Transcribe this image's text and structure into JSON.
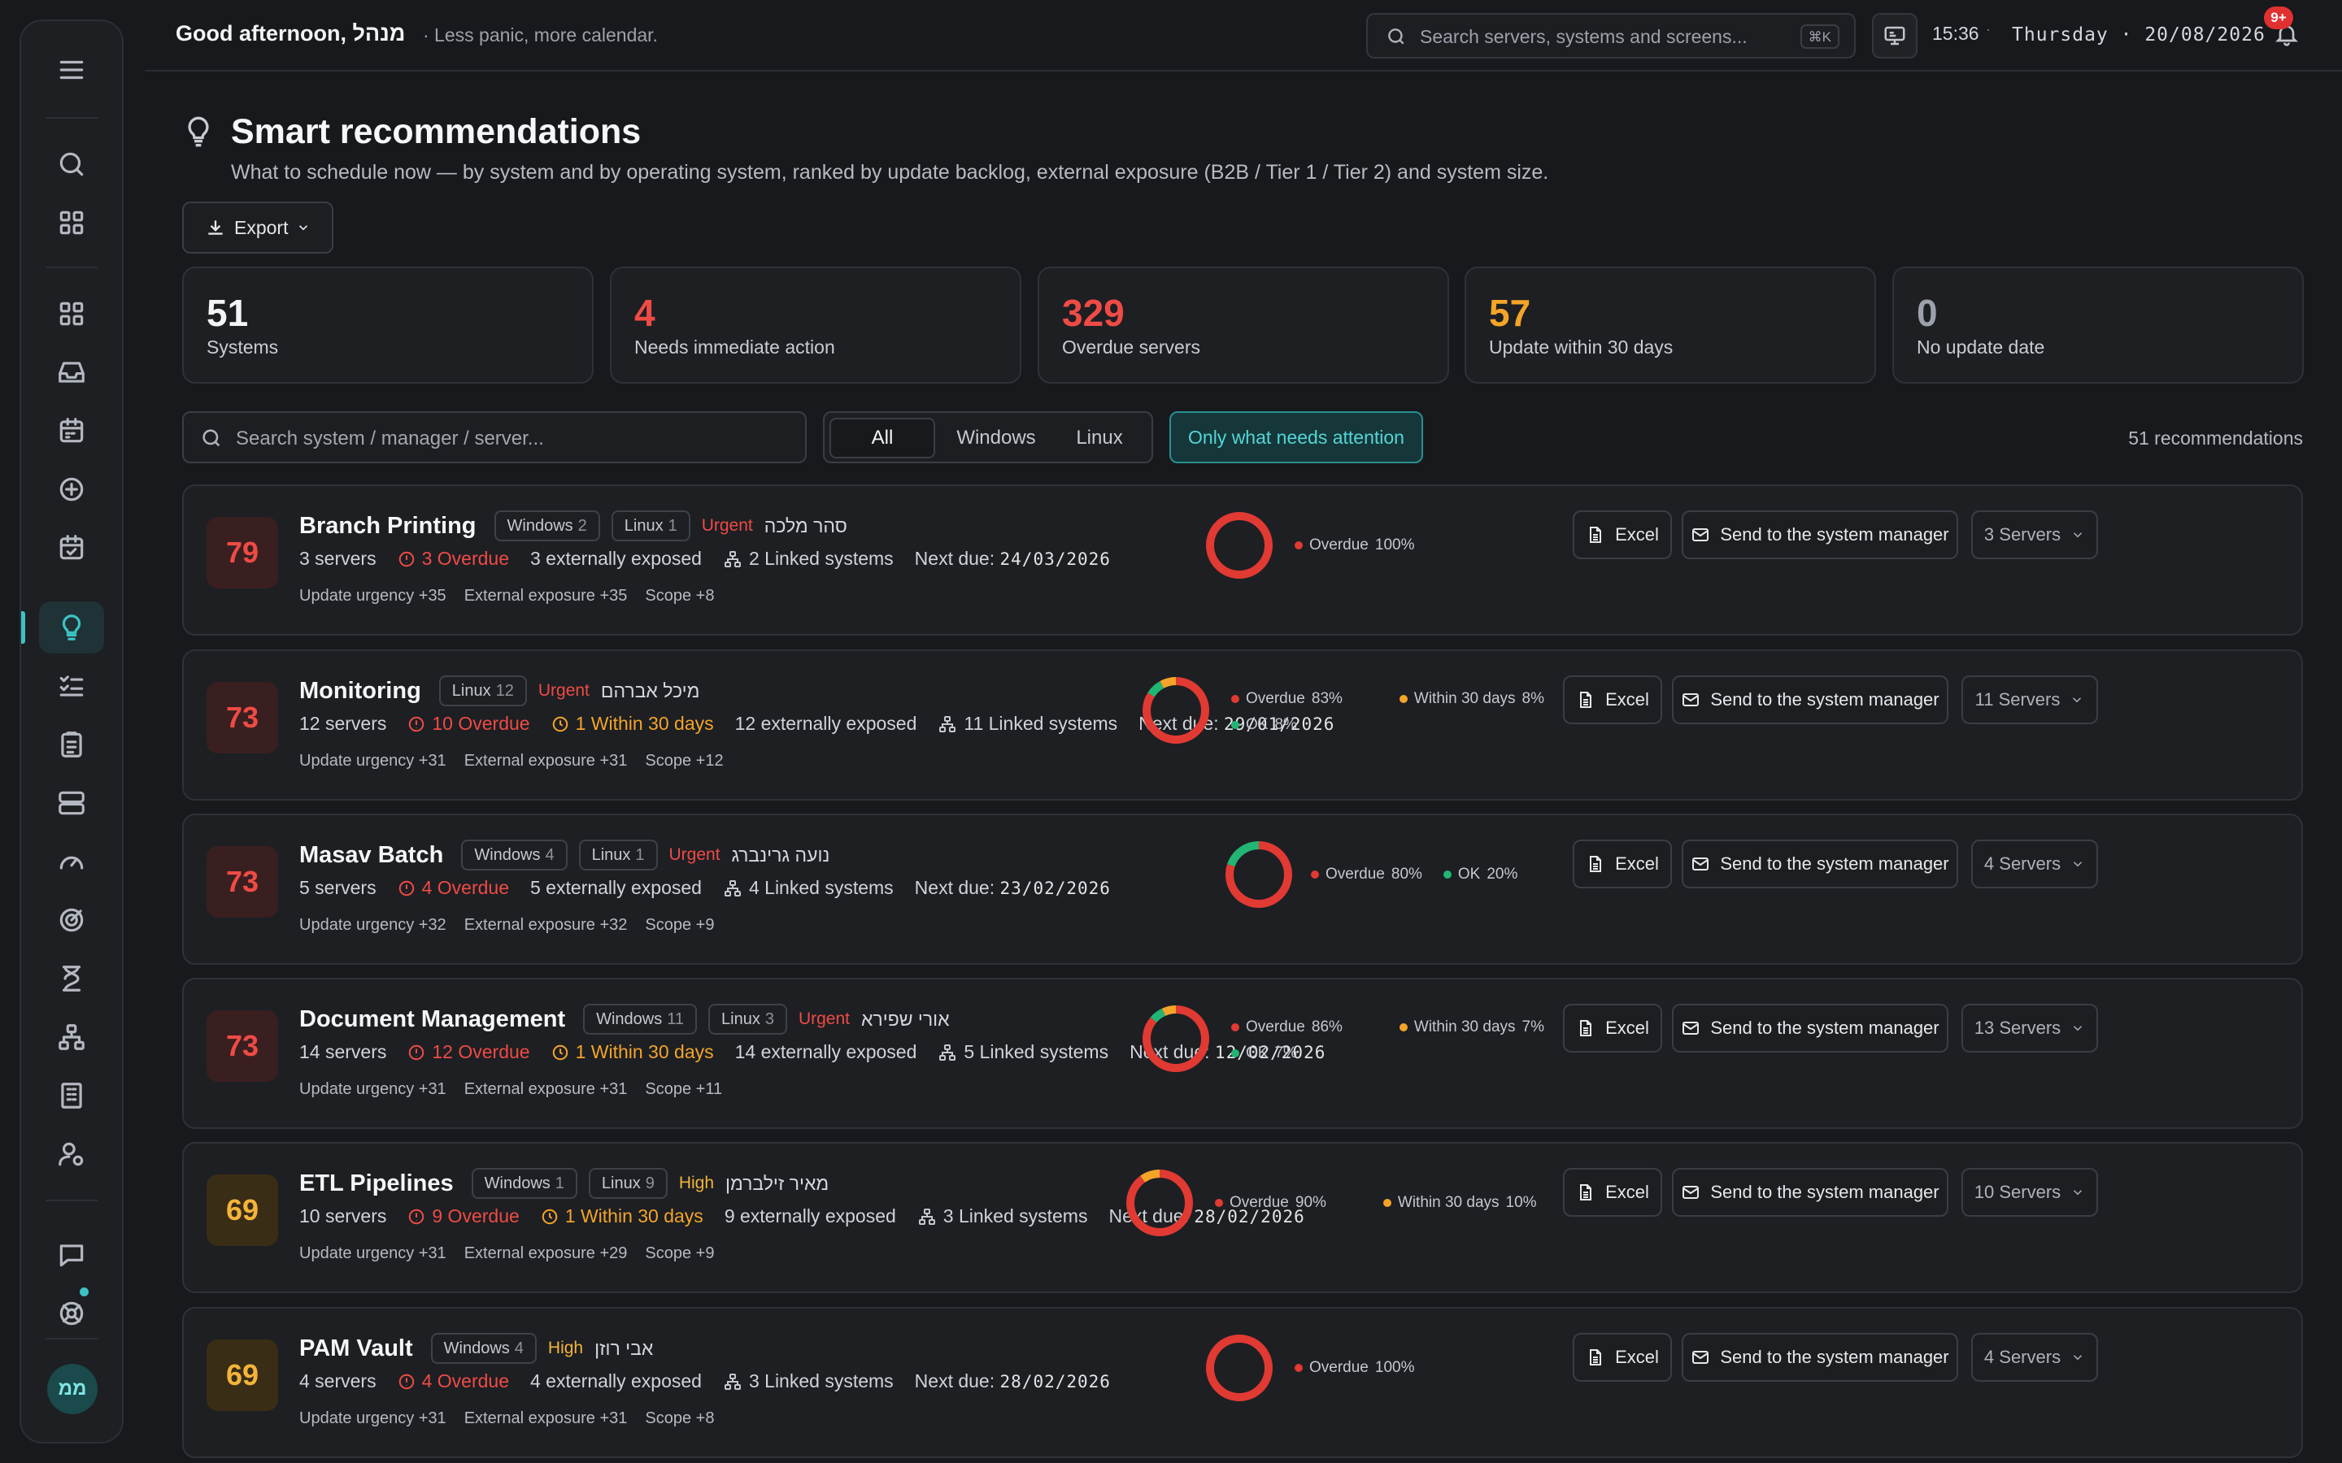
{
  "header": {
    "greeting": "Good afternoon, מנהל",
    "tagline": "· Less panic, more calendar.",
    "search_placeholder": "Search servers, systems and screens...",
    "search_shortcut": "⌘K",
    "time": "15:36",
    "date": "Thursday · 20/08/2026",
    "notifications": "9+"
  },
  "page": {
    "title": "Smart recommendations",
    "subtitle": "What to schedule now — by system and by operating system, ranked by update backlog, external exposure (B2B / Tier 1 / Tier 2) and system size.",
    "export_label": "Export"
  },
  "stats": [
    {
      "value": "51",
      "label": "Systems",
      "color": "#f3f4f6"
    },
    {
      "value": "4",
      "label": "Needs immediate action",
      "color": "#ef4b45"
    },
    {
      "value": "329",
      "label": "Overdue servers",
      "color": "#ef4b45"
    },
    {
      "value": "57",
      "label": "Update within 30 days",
      "color": "#f4a428"
    },
    {
      "value": "0",
      "label": "No update date",
      "color": "#9ca1aa"
    }
  ],
  "filters": {
    "search_placeholder": "Search system / manager / server...",
    "tabs": [
      "All",
      "Windows",
      "Linux"
    ],
    "active_tab": "All",
    "attention_label": "Only what needs attention",
    "count_label": "51 recommendations"
  },
  "colors": {
    "overdue": "#e03a33",
    "within30": "#f4a428",
    "ok": "#22b573",
    "accent": "#3cc3c4"
  },
  "actions": {
    "excel": "Excel",
    "send": "Send to the system manager"
  },
  "cards": [
    {
      "score": "79",
      "priority": "urgent",
      "name": "Branch Printing",
      "os": [
        {
          "name": "Windows",
          "n": "2"
        },
        {
          "name": "Linux",
          "n": "1"
        }
      ],
      "priority_label": "Urgent",
      "owner": "סהר מלכה",
      "servers": "3 servers",
      "overdue": "3 Overdue",
      "within": "",
      "exposed": "3 externally exposed",
      "linked": "2 Linked systems",
      "due_label": "Next due:",
      "due_date": "24/03/2026",
      "urgency": "Update urgency +35",
      "exposure": "External exposure +35",
      "scope": "Scope +8",
      "dist": {
        "overdue": 100,
        "within": 0,
        "ok": 0
      },
      "legend": [
        {
          "label": "Overdue",
          "value": "100%",
          "kind": "overdue"
        }
      ],
      "servers_btn": "3 Servers"
    },
    {
      "score": "73",
      "priority": "urgent",
      "name": "Monitoring",
      "os": [
        {
          "name": "Linux",
          "n": "12"
        }
      ],
      "priority_label": "Urgent",
      "owner": "מיכל אברהם",
      "servers": "12 servers",
      "overdue": "10 Overdue",
      "within": "1 Within 30 days",
      "exposed": "12 externally exposed",
      "linked": "11 Linked systems",
      "due_label": "Next due:",
      "due_date": "29/01/2026",
      "urgency": "Update urgency +31",
      "exposure": "External exposure +31",
      "scope": "Scope +12",
      "dist": {
        "overdue": 83,
        "within": 8,
        "ok": 8
      },
      "legend": [
        {
          "label": "Overdue",
          "value": "83%",
          "kind": "overdue"
        },
        {
          "label": "Within 30 days",
          "value": "8%",
          "kind": "within"
        },
        {
          "label": "OK",
          "value": "8%",
          "kind": "ok"
        }
      ],
      "servers_btn": "11 Servers"
    },
    {
      "score": "73",
      "priority": "urgent",
      "name": "Masav Batch",
      "os": [
        {
          "name": "Windows",
          "n": "4"
        },
        {
          "name": "Linux",
          "n": "1"
        }
      ],
      "priority_label": "Urgent",
      "owner": "נועה גרינברג",
      "servers": "5 servers",
      "overdue": "4 Overdue",
      "within": "",
      "exposed": "5 externally exposed",
      "linked": "4 Linked systems",
      "due_label": "Next due:",
      "due_date": "23/02/2026",
      "urgency": "Update urgency +32",
      "exposure": "External exposure +32",
      "scope": "Scope +9",
      "dist": {
        "overdue": 80,
        "within": 0,
        "ok": 20
      },
      "legend": [
        {
          "label": "Overdue",
          "value": "80%",
          "kind": "overdue"
        },
        {
          "label": "OK",
          "value": "20%",
          "kind": "ok"
        }
      ],
      "servers_btn": "4 Servers"
    },
    {
      "score": "73",
      "priority": "urgent",
      "name": "Document Management",
      "os": [
        {
          "name": "Windows",
          "n": "11"
        },
        {
          "name": "Linux",
          "n": "3"
        }
      ],
      "priority_label": "Urgent",
      "owner": "אורי שפירא",
      "servers": "14 servers",
      "overdue": "12 Overdue",
      "within": "1 Within 30 days",
      "exposed": "14 externally exposed",
      "linked": "5 Linked systems",
      "due_label": "Next due:",
      "due_date": "12/02/2026",
      "urgency": "Update urgency +31",
      "exposure": "External exposure +31",
      "scope": "Scope +11",
      "dist": {
        "overdue": 86,
        "within": 7,
        "ok": 7
      },
      "legend": [
        {
          "label": "Overdue",
          "value": "86%",
          "kind": "overdue"
        },
        {
          "label": "Within 30 days",
          "value": "7%",
          "kind": "within"
        },
        {
          "label": "OK",
          "value": "7%",
          "kind": "ok"
        }
      ],
      "servers_btn": "13 Servers"
    },
    {
      "score": "69",
      "priority": "high",
      "name": "ETL Pipelines",
      "os": [
        {
          "name": "Windows",
          "n": "1"
        },
        {
          "name": "Linux",
          "n": "9"
        }
      ],
      "priority_label": "High",
      "owner": "מאיר זילברמן",
      "servers": "10 servers",
      "overdue": "9 Overdue",
      "within": "1 Within 30 days",
      "exposed": "9 externally exposed",
      "linked": "3 Linked systems",
      "due_label": "Next due:",
      "due_date": "28/02/2026",
      "urgency": "Update urgency +31",
      "exposure": "External exposure +29",
      "scope": "Scope +9",
      "dist": {
        "overdue": 90,
        "within": 10,
        "ok": 0
      },
      "legend": [
        {
          "label": "Overdue",
          "value": "90%",
          "kind": "overdue"
        },
        {
          "label": "Within 30 days",
          "value": "10%",
          "kind": "within"
        }
      ],
      "servers_btn": "10 Servers"
    },
    {
      "score": "69",
      "priority": "high",
      "name": "PAM Vault",
      "os": [
        {
          "name": "Windows",
          "n": "4"
        }
      ],
      "priority_label": "High",
      "owner": "אבי רוזן",
      "servers": "4 servers",
      "overdue": "4 Overdue",
      "within": "",
      "exposed": "4 externally exposed",
      "linked": "3 Linked systems",
      "due_label": "Next due:",
      "due_date": "28/02/2026",
      "urgency": "Update urgency +31",
      "exposure": "External exposure +31",
      "scope": "Scope +8",
      "dist": {
        "overdue": 100,
        "within": 0,
        "ok": 0
      },
      "legend": [
        {
          "label": "Overdue",
          "value": "100%",
          "kind": "overdue"
        }
      ],
      "servers_btn": "4 Servers"
    }
  ],
  "sidebar": {
    "avatar": "ממ",
    "icons": [
      "menu-icon",
      "search-icon",
      "apps-grid-icon",
      "dashboard-icon",
      "inbox-icon",
      "calendar-icon",
      "add-circle-icon",
      "calendar-check-icon",
      "lightbulb-icon",
      "checklist-icon",
      "clipboard-icon",
      "server-icon",
      "gauge-icon",
      "target-icon",
      "hourglass-icon",
      "sitemap-icon",
      "building-icon",
      "user-settings-icon",
      "chat-icon",
      "help-icon"
    ]
  }
}
